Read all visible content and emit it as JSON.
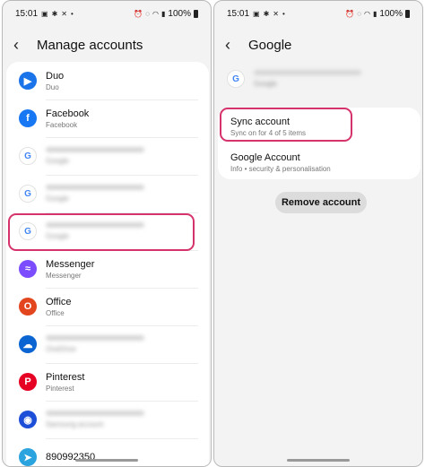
{
  "left": {
    "status_time": "15:01",
    "status_battery": "100%",
    "back_icon": "arrow-left-icon",
    "title": "Manage accounts",
    "accounts": [
      {
        "name": "Duo",
        "type": "Duo",
        "icon": "duo-icon",
        "color": "#1a73e8",
        "blurred": false
      },
      {
        "name": "Facebook",
        "type": "Facebook",
        "icon": "facebook-icon",
        "color": "#1877f2",
        "blurred": false
      },
      {
        "name": "",
        "type": "Google",
        "icon": "google-icon",
        "color": "#4285f4",
        "blurred": true
      },
      {
        "name": "",
        "type": "Google",
        "icon": "google-icon",
        "color": "#4285f4",
        "blurred": true
      },
      {
        "name": "",
        "type": "Google",
        "icon": "google-icon",
        "color": "#4285f4",
        "blurred": true
      },
      {
        "name": "Messenger",
        "type": "Messenger",
        "icon": "messenger-icon",
        "color": "#7b4dff",
        "blurred": false
      },
      {
        "name": "Office",
        "type": "Office",
        "icon": "office-icon",
        "color": "#e3461f",
        "blurred": false
      },
      {
        "name": "",
        "type": "OneDrive",
        "icon": "onedrive-icon",
        "color": "#0a64d2",
        "blurred": true
      },
      {
        "name": "Pinterest",
        "type": "Pinterest",
        "icon": "pinterest-icon",
        "color": "#e60023",
        "blurred": false
      },
      {
        "name": "",
        "type": "Samsung account",
        "icon": "samsung-account-icon",
        "color": "#1d4ed8",
        "blurred": true
      },
      {
        "name": "890992350",
        "type": "",
        "icon": "telegram-icon",
        "color": "#2aa3df",
        "blurred": false
      }
    ]
  },
  "right": {
    "status_time": "15:01",
    "status_battery": "100%",
    "back_icon": "arrow-left-icon",
    "title": "Google",
    "account_type": "Google",
    "sync": {
      "label": "Sync account",
      "sub": "Sync on for 4 of 5 items"
    },
    "google_account": {
      "label": "Google Account",
      "sub": "Info  •  security & personalisation"
    },
    "remove_label": "Remove account"
  },
  "colors": {
    "highlight": "#d6336c",
    "background": "#f3f3f3",
    "card": "#ffffff"
  }
}
